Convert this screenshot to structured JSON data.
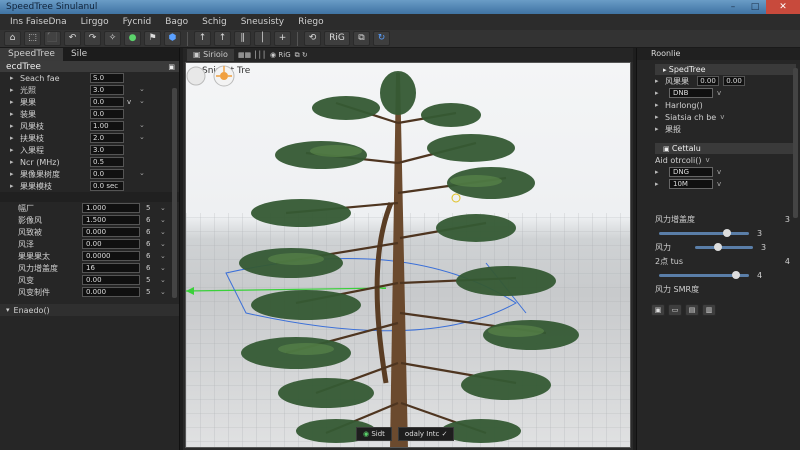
{
  "window": {
    "title": "SpeedTree Sinulanul",
    "controls": [
      "–",
      "□",
      "✕"
    ]
  },
  "menu": [
    "Ins FaiseDna",
    "Lirggo",
    "Fycnid",
    "Bago",
    "Schig",
    "Sneusisty",
    "Riego"
  ],
  "toolbar": {
    "buttons": [
      "⌂",
      "⬚",
      "⬛",
      "↶",
      "↷",
      "✧",
      "●",
      "⚑",
      "⬢",
      "↑",
      "↑",
      "∥",
      "│",
      "+",
      "⟲",
      "RiG",
      "⧉",
      "↻"
    ]
  },
  "left_panel": {
    "tabs": [
      "SpeedTree",
      "Sile"
    ],
    "header": "ecdTree",
    "props": [
      {
        "label": "Seach fae",
        "value": "S.0",
        "unit": ""
      },
      {
        "label": "光照",
        "value": "3.0",
        "unit": ""
      },
      {
        "label": "果果",
        "value": "0.0",
        "unit": "v"
      },
      {
        "label": "装果",
        "value": "0.0",
        "unit": ""
      },
      {
        "label": "风果枝",
        "value": "1.00",
        "unit": ""
      },
      {
        "label": "扶果枝",
        "value": "2.0",
        "unit": ""
      },
      {
        "label": "入果程",
        "value": "3.0",
        "unit": ""
      },
      {
        "label": "Ncr (MHz)",
        "value": "0.5",
        "unit": ""
      },
      {
        "label": "果像果树度",
        "value": "0.0",
        "unit": ""
      },
      {
        "label": "果果模枝",
        "value": "0.0 sec",
        "unit": ""
      }
    ],
    "numeric": [
      {
        "label": "幅厂",
        "value": "1.000",
        "num": "5"
      },
      {
        "label": "影像风",
        "value": "1.500",
        "num": "6"
      },
      {
        "label": "风致被",
        "value": "0.000",
        "num": "6"
      },
      {
        "label": "风泽",
        "value": "0.00",
        "num": "6"
      },
      {
        "label": "果果果太",
        "value": "0.0000",
        "num": "6"
      },
      {
        "label": "风力增盖度",
        "value": "16",
        "num": "6"
      },
      {
        "label": "风变",
        "value": "0.00",
        "num": "5"
      },
      {
        "label": "风变制件",
        "value": "0.000",
        "num": "5"
      }
    ],
    "collapse": "Enaedo()"
  },
  "viewport": {
    "tabs": [
      "▣ Sirioio",
      "▦▦ │││",
      "◉ RiG",
      "⧉ ↻"
    ],
    "title": "Sniraet Tre",
    "footer": [
      {
        "icon": "◉",
        "label": "Sidt"
      },
      {
        "icon": "",
        "label": "odaly Intc"
      }
    ]
  },
  "right_panel": {
    "title": "Roonlie",
    "section1": "SpedTree",
    "rows1": [
      {
        "label": "风果果",
        "a": "0.00",
        "b": "0.00"
      },
      {
        "label": "DNB",
        "dd": "v"
      },
      {
        "label": "Harlong()",
        "dd": ""
      },
      {
        "label": "Siatsia ch be",
        "dd": "v"
      },
      {
        "label": "果报",
        "dd": ""
      }
    ],
    "section2": "Cettalu",
    "rows2": [
      {
        "label": "Aid otrcoli()",
        "dd": "v"
      },
      {
        "label": "DNG",
        "dd": "v"
      },
      {
        "label": "10M",
        "dd": "v"
      }
    ],
    "sliders": [
      {
        "label": "风力增盖度",
        "n": "3",
        "pos": 0.75
      },
      {
        "label": "风力",
        "n": "3",
        "pos": 0.4
      },
      {
        "label": "2点 tus",
        "n": "4",
        "pos": 0.85
      }
    ],
    "slider_tail": "风力 SMR度",
    "slider_right_num": "3",
    "bottom_buttons": [
      "▣",
      "▭",
      "▤",
      "▥"
    ]
  }
}
